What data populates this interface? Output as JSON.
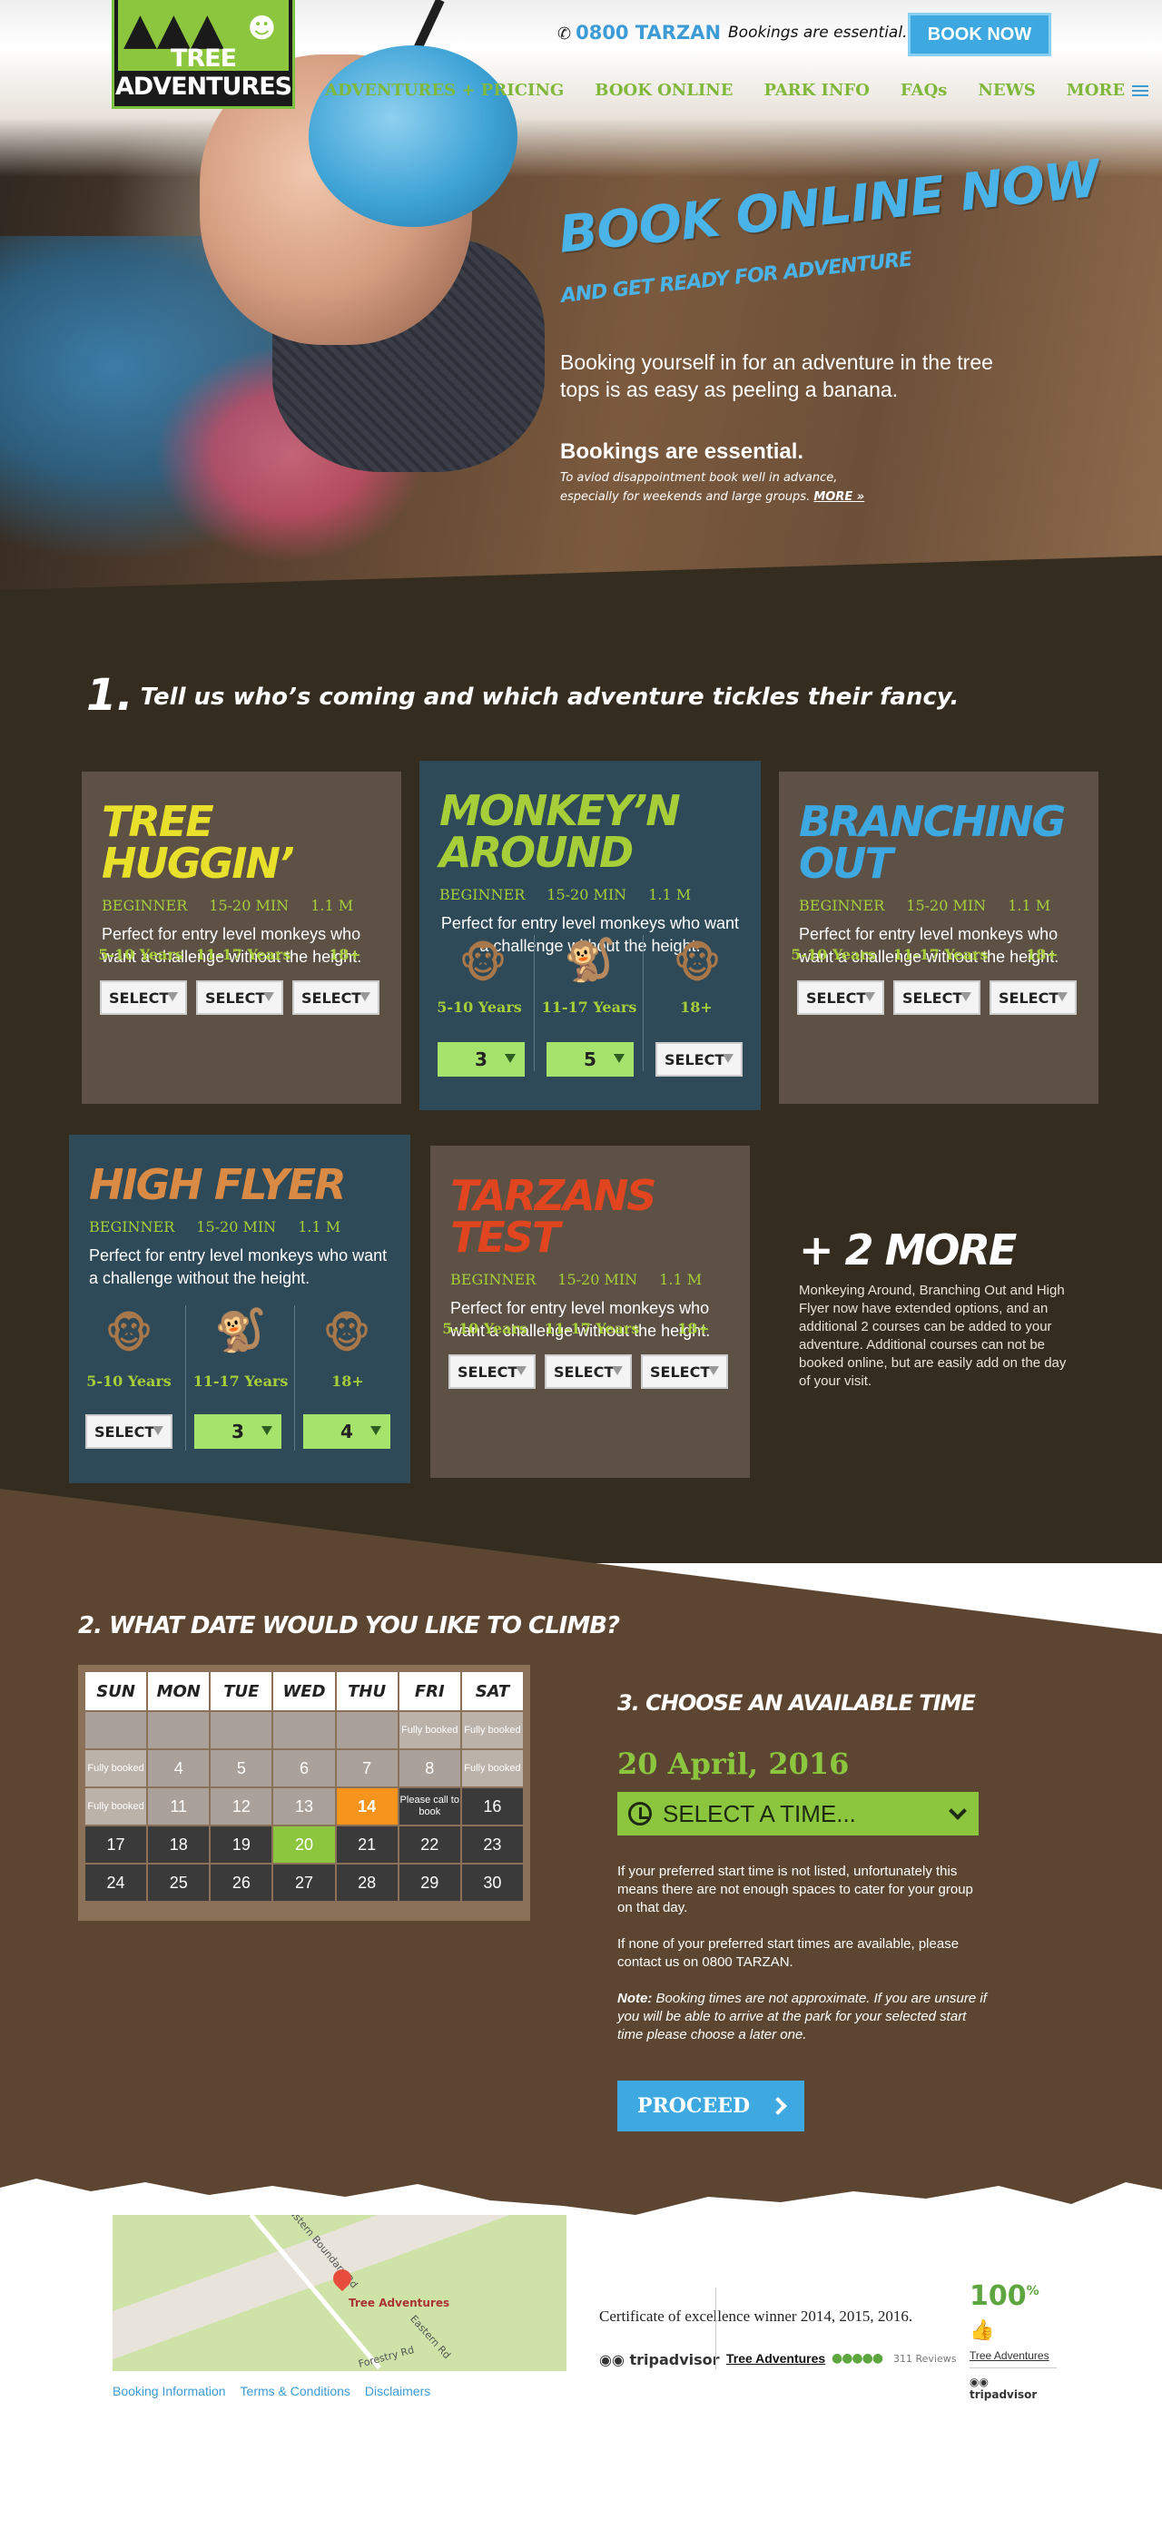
{
  "header": {
    "logo_text": "TREE ADVENTURES",
    "phone": "0800 TARZAN",
    "note": "Bookings are essential.",
    "book_now": "BOOK NOW",
    "nav": [
      "ADVENTURES + PRICING",
      "BOOK ONLINE",
      "PARK INFO",
      "FAQs",
      "NEWS",
      "MORE"
    ]
  },
  "hero": {
    "title": "BOOK ONLINE NOW",
    "subtitle": "AND GET READY FOR ADVENTURE",
    "body": "Booking yourself in for an adventure in the tree tops is as easy as peeling a banana.",
    "essential": "Bookings are essential.",
    "small": "To aviod disappointment book well in advance, especially for weekends and large groups.",
    "more_link": "MORE »"
  },
  "step1": {
    "num": "1.",
    "text": "Tell us who’s coming and which adventure tickles their fancy."
  },
  "courses": [
    {
      "title": "TREE HUGGIN’",
      "color": "#e8e02a",
      "level": "BEGINNER",
      "time": "15-20 MIN",
      "height": "1.1 M",
      "desc": "Perfect for entry level monkeys who want a challenge without the height.",
      "ages": [
        "5-10 Years",
        "11-17 Years",
        "18+"
      ],
      "selects": [
        "SELECT",
        "SELECT",
        "SELECT"
      ]
    },
    {
      "title": "MONKEY’N AROUND",
      "color": "#a6ce39",
      "level": "BEGINNER",
      "time": "15-20 MIN",
      "height": "1.1 M",
      "desc": "Perfect for entry level monkeys who want a challenge without the height.",
      "ages": [
        "5-10 Years",
        "11-17 Years",
        "18+"
      ],
      "selects": [
        "3",
        "5",
        "SELECT"
      ]
    },
    {
      "title": "BRANCHING OUT",
      "color": "#3da9e0",
      "level": "BEGINNER",
      "time": "15-20 MIN",
      "height": "1.1 M",
      "desc": "Perfect for entry level monkeys who want a challenge without the height.",
      "ages": [
        "5-10 Years",
        "11-17 Years",
        "18+"
      ],
      "selects": [
        "SELECT",
        "SELECT",
        "SELECT"
      ]
    },
    {
      "title": "HIGH FLYER",
      "color": "#d98a45",
      "level": "BEGINNER",
      "time": "15-20 MIN",
      "height": "1.1 M",
      "desc": "Perfect for entry level monkeys who want a challenge without the height.",
      "ages": [
        "5-10 Years",
        "11-17 Years",
        "18+"
      ],
      "selects": [
        "SELECT",
        "3",
        "4"
      ]
    },
    {
      "title": "TARZANS TEST",
      "color": "#e0451f",
      "level": "BEGINNER",
      "time": "15-20 MIN",
      "height": "1.1 M",
      "desc": "Perfect for entry level monkeys who want a challenge without the height.",
      "ages": [
        "5-10 Years",
        "11-17 Years",
        "18+"
      ],
      "selects": [
        "SELECT",
        "SELECT",
        "SELECT"
      ]
    }
  ],
  "more": {
    "title": "+ 2 MORE",
    "text": "Monkeying Around, Branching Out and High Flyer now have extended options, and an additional 2 courses can be added to your adventure. Additional courses can not be booked online, but are easily add on the day of your visit."
  },
  "step2": {
    "title": "2. WHAT DATE WOULD YOU LIKE TO CLIMB?"
  },
  "calendar": {
    "days": [
      "SUN",
      "MON",
      "TUE",
      "WED",
      "THU",
      "FRI",
      "SAT"
    ],
    "fully_booked": "Fully booked",
    "call": "Please call to book",
    "rows": [
      [
        "",
        "",
        "",
        "",
        "",
        "Fully booked",
        "Fully booked"
      ],
      [
        "Fully booked",
        "4",
        "5",
        "6",
        "7",
        "8",
        "Fully booked"
      ],
      [
        "Fully booked",
        "11",
        "12",
        "13",
        "14",
        "Please call to book",
        "16"
      ],
      [
        "17",
        "18",
        "19",
        "20",
        "21",
        "22",
        "23"
      ],
      [
        "24",
        "25",
        "26",
        "27",
        "28",
        "29",
        "30"
      ]
    ]
  },
  "step3": {
    "title": "3. CHOOSE AN AVAILABLE TIME",
    "date": "20 April, 2016",
    "select": "SELECT A TIME...",
    "info1": "If your preferred start time is not listed, unfortunately this means there are not enough spaces to cater for your group on that day.",
    "info2": "If none of your preferred start times are available, please contact us on 0800 TARZAN.",
    "note_label": "Note:",
    "note": "Booking times are not approximate. If you are unsure if you will be able to arrive at the park for your selected start time please choose a later one.",
    "proceed": "PROCEED"
  },
  "footer": {
    "map_label": "Tree Adventures",
    "roads": [
      "Eastern Boundary Rd",
      "Eastern Rd",
      "Forestry Rd"
    ],
    "links": [
      "Booking Information",
      "Terms & Conditions",
      "Disclaimers"
    ],
    "cert": "Certificate of excellence winner 2014, 2015, 2016.",
    "ta_logo": "tripadvisor",
    "ta_name": "Tree Adventures",
    "reviews": "311 Reviews",
    "badge_pct": "100",
    "badge_name": "Tree Adventures",
    "badge_ta": "tripadvisor"
  }
}
